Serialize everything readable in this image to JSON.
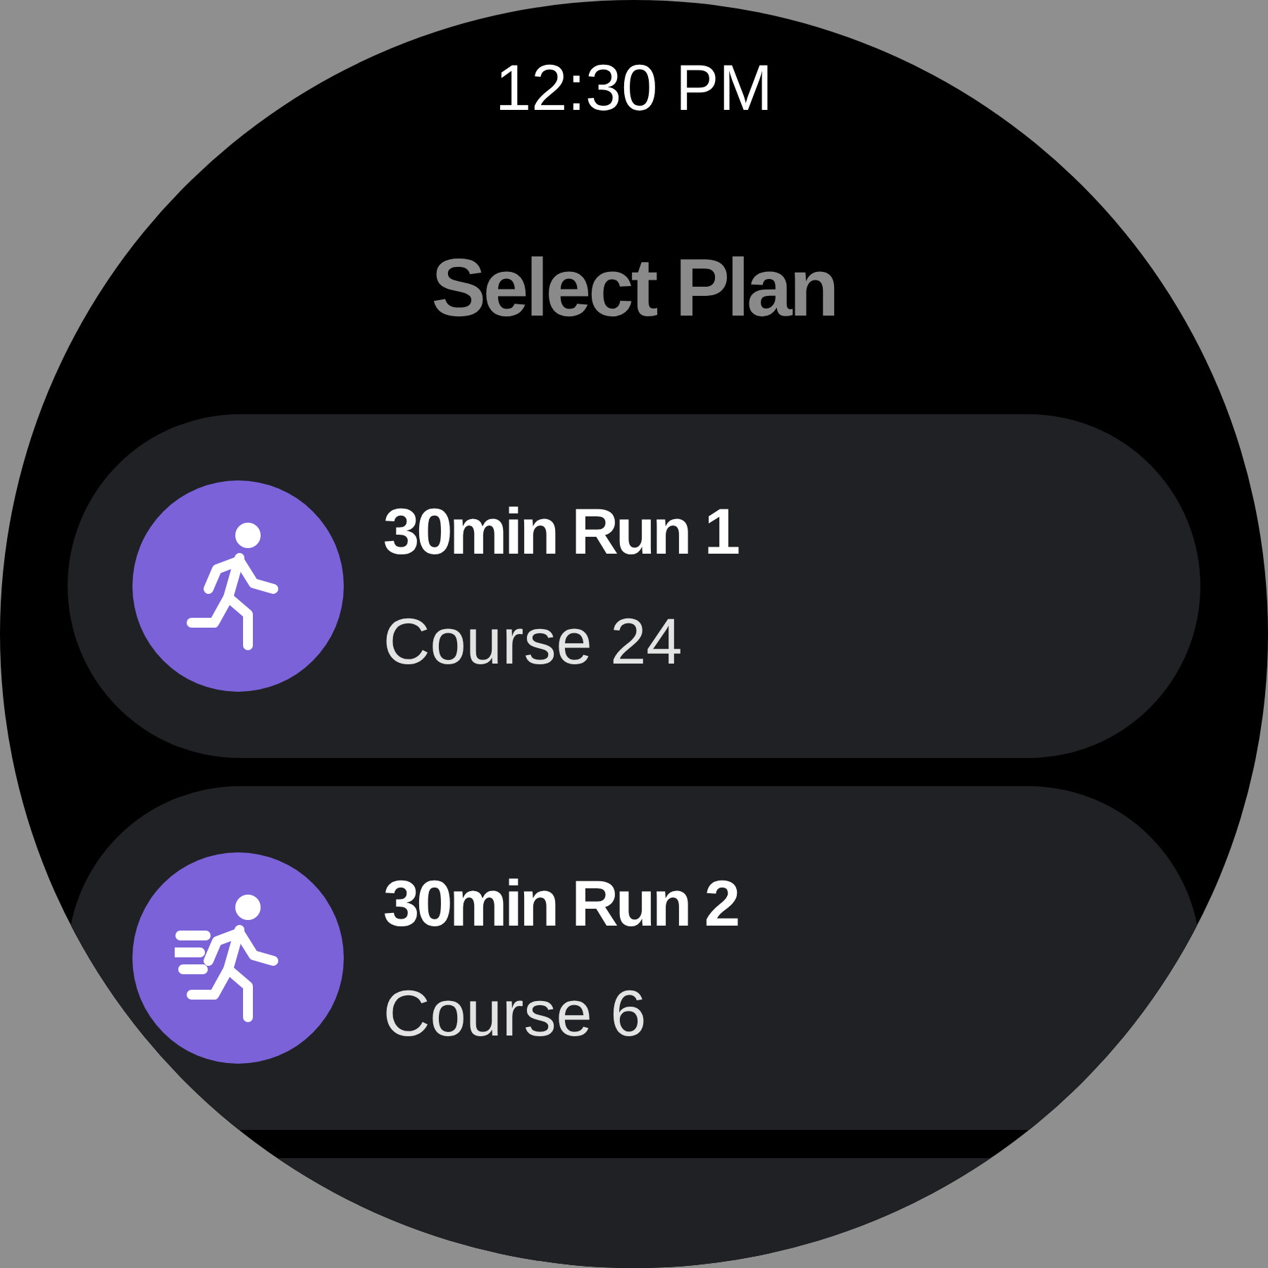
{
  "status_bar": {
    "time": "12:30 PM"
  },
  "title": "Select Plan",
  "plans": [
    {
      "kind": "run",
      "title": "30min Run 1",
      "subtitle": "Course 24"
    },
    {
      "kind": "sprint",
      "title": "30min Run 2",
      "subtitle": "Course 6"
    }
  ]
}
